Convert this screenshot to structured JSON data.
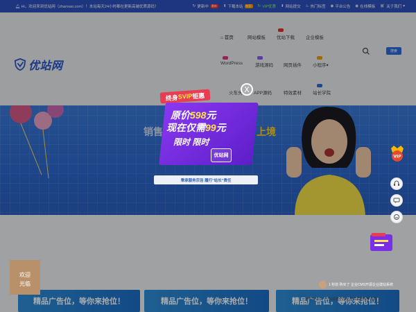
{
  "topbar": {
    "welcome": "Hi，欢迎来到优站网（zhanxao.com）！本站每天24小时都在更新高端优质源码！",
    "links": [
      {
        "label": "更新中",
        "tag": "最新"
      },
      {
        "label": "下载本站",
        "tag": "有奖"
      },
      {
        "label": "VIP优惠",
        "tag": ""
      },
      {
        "label": "网站提交",
        "tag": ""
      },
      {
        "label": "热门标签",
        "tag": ""
      },
      {
        "label": "平台公告",
        "tag": ""
      },
      {
        "label": "在线模板",
        "tag": ""
      },
      {
        "label": "关于我们",
        "tag": ""
      }
    ]
  },
  "header": {
    "logo_text": "优站网",
    "nav": {
      "row1": [
        "首页",
        "网站模板",
        "优站下载",
        "企业模板"
      ],
      "row2": [
        "WordPress",
        "游戏源码",
        "网页插件",
        "小程序"
      ],
      "row3": [
        "火车头",
        "APP源码",
        "特效素材",
        "站长学院"
      ]
    },
    "search_button": "搜索"
  },
  "banner": {
    "headline_left": "销售",
    "headline_right": "上境"
  },
  "popup": {
    "title_prefix": "终身",
    "title_highlight": "SVIP",
    "title_suffix": "钜惠",
    "price_line1_prefix": "原价",
    "price_line1_num": "598",
    "price_line1_suffix": "元",
    "price_line2_prefix": "现在仅需",
    "price_line2_num": "99",
    "price_line2_suffix": "元",
    "limited": "限时 限时",
    "mini_logo": "优站网",
    "slogan": "秉承服务宗旨 履行\"站长\"责任",
    "close_glyph": "X"
  },
  "ads": [
    "精品广告位，等你来抢位！",
    "精品广告位，等你来抢位！",
    "精品广告位，等你来抢位！"
  ],
  "rail": {
    "vip_label": "VIP"
  },
  "welcome_box": {
    "line1": "欢迎",
    "line2": "光临"
  },
  "ticker": {
    "line1": "1 秒前 购买了 企业CMS开源企业建站系统",
    "line2": "PHP开源(一)一款易捷全行业发卡系统程序源码"
  },
  "colors": {
    "topbar": "#2d4fbf",
    "brand": "#2b56c6",
    "popup_purple": "#7a2ee6",
    "title_red": "#e83d52",
    "price_yellow": "#ffe44a"
  }
}
